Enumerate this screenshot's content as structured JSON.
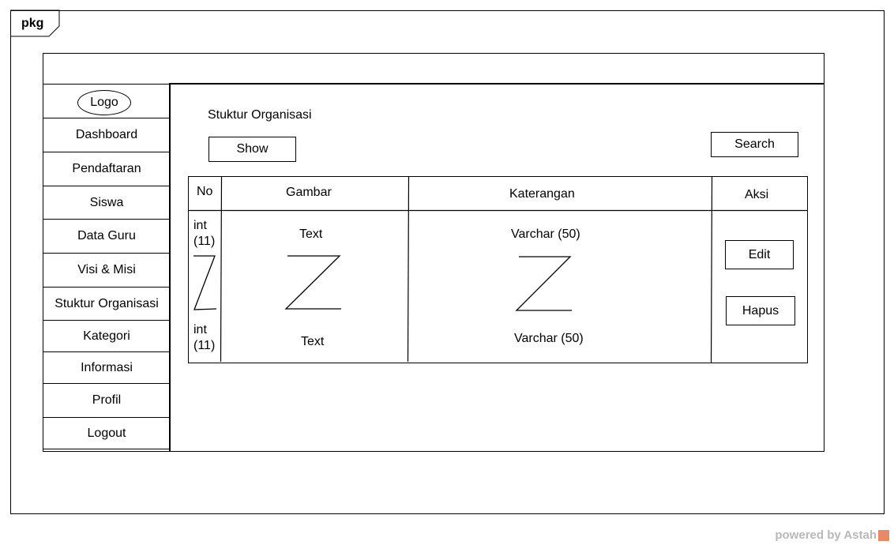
{
  "diagram": {
    "package_label": "pkg",
    "logo": "Logo",
    "sidebar": {
      "items": [
        {
          "label": "Dashboard"
        },
        {
          "label": "Pendaftaran"
        },
        {
          "label": "Siswa"
        },
        {
          "label": "Data Guru"
        },
        {
          "label": "Visi & Misi"
        },
        {
          "label": "Stuktur Organisasi"
        },
        {
          "label": "Kategori"
        },
        {
          "label": "Informasi"
        },
        {
          "label": "Profil"
        },
        {
          "label": "Logout"
        }
      ]
    },
    "main": {
      "title": "Stuktur Organisasi",
      "show_button": "Show",
      "search_button": "Search",
      "table": {
        "headers": [
          "No",
          "Gambar",
          "Katerangan",
          "Aksi"
        ],
        "no_first_top": "int",
        "no_first_bottom": "(11)",
        "no_last_top": "int",
        "no_last_bottom": "(11)",
        "gambar_first": "Text",
        "gambar_last": "Text",
        "keterangan_first": "Varchar (50)",
        "keterangan_last": "Varchar (50)",
        "edit_button": "Edit",
        "hapus_button": "Hapus"
      }
    },
    "watermark": "powered by Astah"
  }
}
